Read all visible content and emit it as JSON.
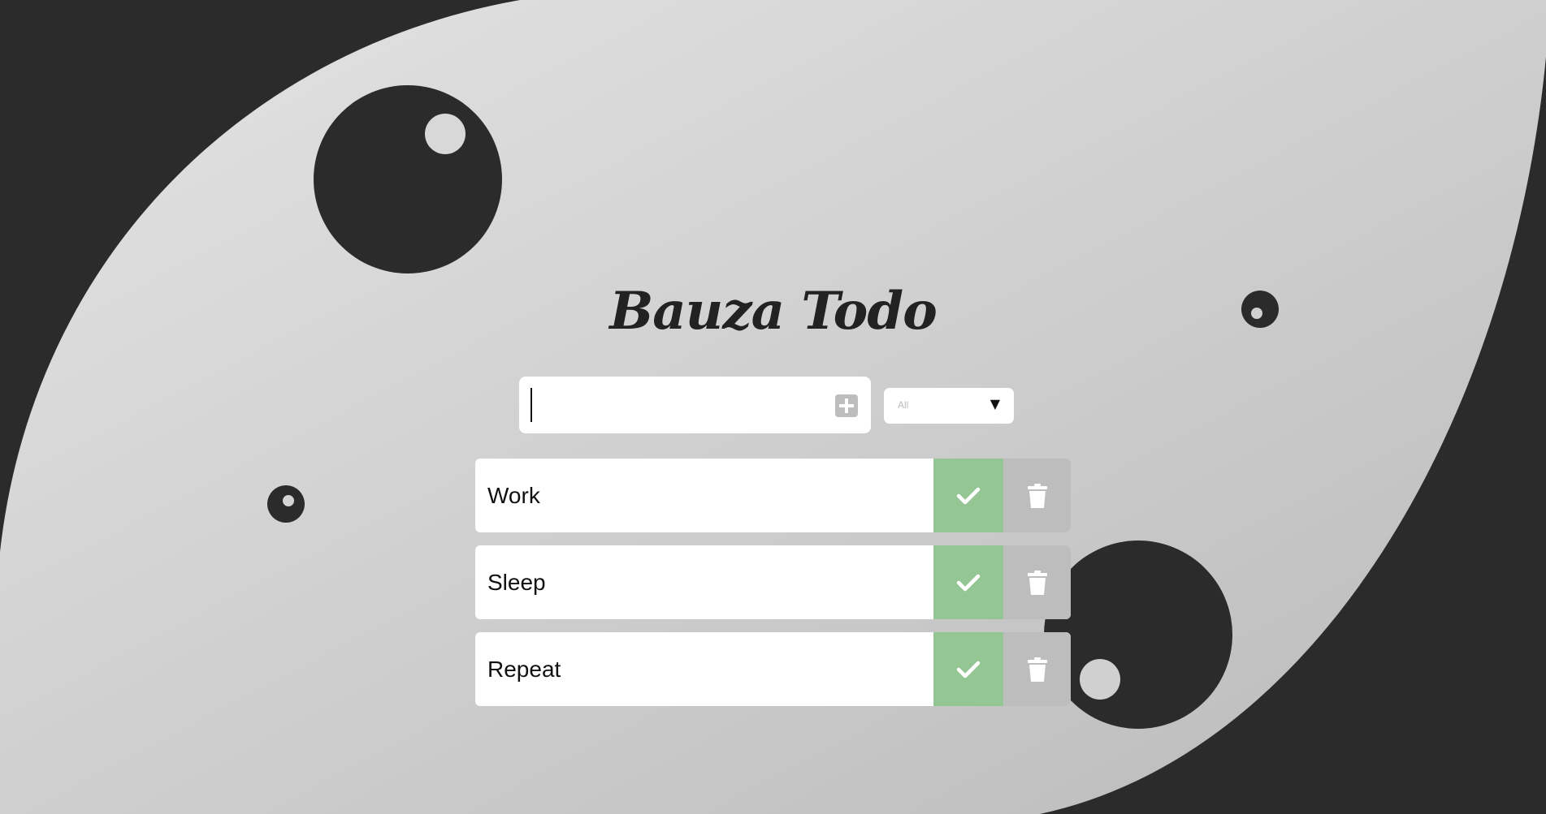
{
  "app": {
    "title": "Bauza Todo"
  },
  "form": {
    "input_value": "",
    "add_icon": "plus-square-icon"
  },
  "filter": {
    "selected": "All",
    "caret": "▼"
  },
  "todos": [
    {
      "text": "Work"
    },
    {
      "text": "Sleep"
    },
    {
      "text": "Repeat"
    }
  ],
  "actions": {
    "complete_icon": "check-icon",
    "delete_icon": "trash-icon"
  },
  "colors": {
    "background_dark": "#2b2b2b",
    "background_light": "#d6d6d6",
    "complete_green": "#94c694",
    "delete_gray": "#bdbdbd",
    "card_white": "#ffffff"
  }
}
